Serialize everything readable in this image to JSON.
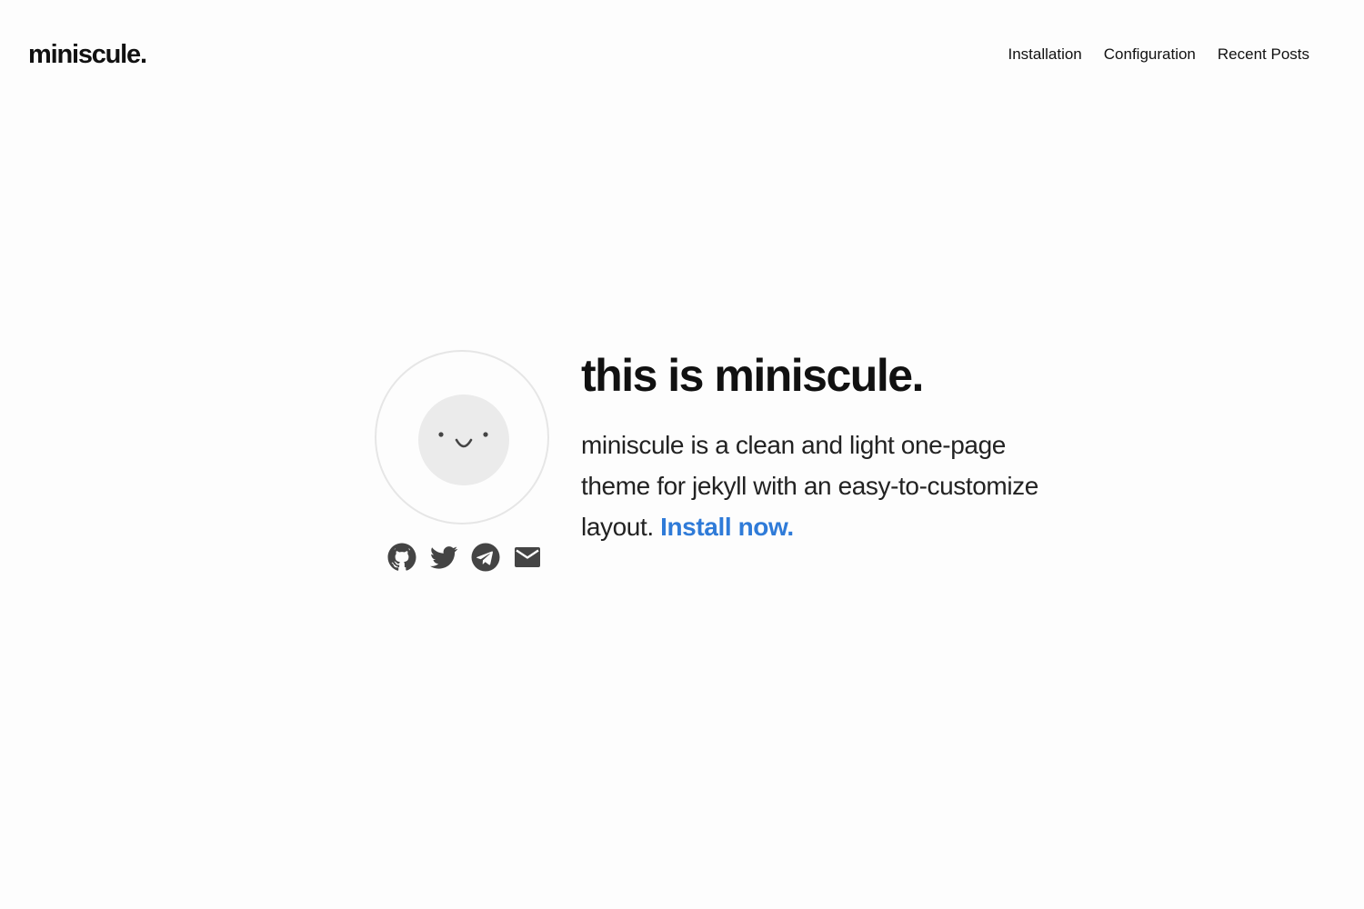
{
  "header": {
    "logo": "miniscule.",
    "nav": [
      {
        "label": "Installation"
      },
      {
        "label": "Configuration"
      },
      {
        "label": "Recent Posts"
      }
    ]
  },
  "hero": {
    "title": "this is miniscule.",
    "description": "miniscule is a clean and light one-page theme for jekyll with an easy-to-customize layout.",
    "cta_label": "Install now.",
    "avatar": "smiley-face-icon",
    "social": [
      {
        "icon": "github-icon"
      },
      {
        "icon": "twitter-icon"
      },
      {
        "icon": "telegram-icon"
      },
      {
        "icon": "email-icon"
      }
    ]
  },
  "colors": {
    "background": "#fdfdfd",
    "text": "#111111",
    "link": "#2f7bd8",
    "icon": "#444444",
    "avatar_ring": "#e6e6e6",
    "avatar_fill": "#ebebeb"
  }
}
